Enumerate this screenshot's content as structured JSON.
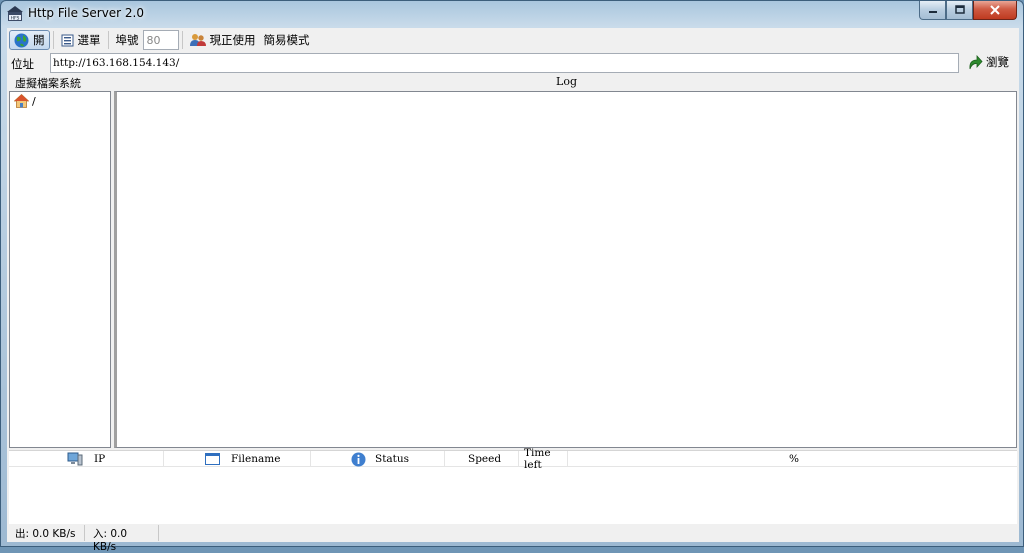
{
  "window": {
    "title": "Http File Server 2.0",
    "app_icon": "hfs-icon"
  },
  "toolbar": {
    "open_label": "開",
    "menu_label": "選單",
    "port_label": "埠號",
    "port_value": "80",
    "in_use_label": "現正使用",
    "simple_mode_label": "簡易模式"
  },
  "address": {
    "label": "位址",
    "value": "http://163.168.154.143/",
    "browse_label": "瀏覽"
  },
  "panels": {
    "vfs_header": "虛擬檔案系統",
    "log_header": "Log",
    "vfs_root": "/"
  },
  "transfers": {
    "columns": [
      "IP",
      "Filename",
      "Status",
      "Speed",
      "Time left",
      "%"
    ]
  },
  "statusbar": {
    "out": "出: 0.0 KB/s",
    "in": "入: 0.0 KB/s"
  },
  "colors": {
    "titlebar": "#a9c6de",
    "close_button": "#c9442b",
    "client_bg": "#f0f0f0"
  }
}
